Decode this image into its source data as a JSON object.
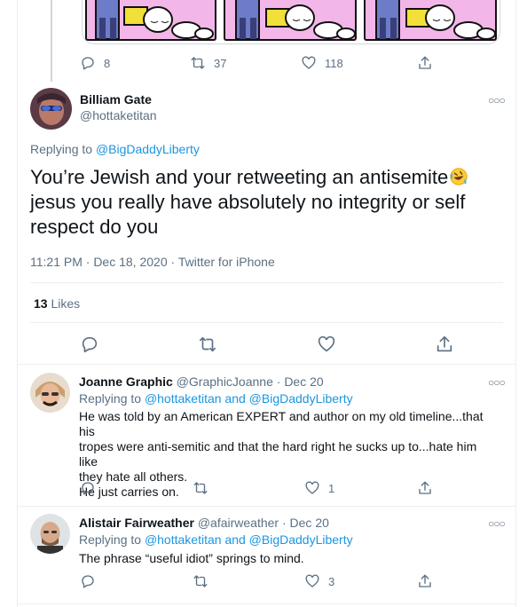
{
  "parent_tweet": {
    "counts": {
      "replies": "8",
      "retweets": "37",
      "likes": "118"
    }
  },
  "main_tweet": {
    "name": "Billiam Gate",
    "handle": "@hottaketitan",
    "replying_prefix": "Replying to",
    "replying_to": "@BigDaddyLiberty",
    "text": "You’re Jewish and your retweeting an antisemite",
    "text_cont": "jesus you really have absolutely no integrity or self respect do you",
    "timestamp": "11:21 PM · Dec 18, 2020",
    "source": "Twitter for iPhone",
    "likes_count": "13",
    "likes_label": "Likes"
  },
  "replies": [
    {
      "name": "Joanne Graphic",
      "handle": "@GraphicJoanne",
      "date": "· Dec 20",
      "replying_prefix": "Replying to",
      "replying_to": "@hottaketitan and @BigDaddyLiberty",
      "lines": [
        "He was told by an American EXPERT and author on my old timeline...that his",
        "tropes were anti-semitic and that the hard right he sucks up to...hate him like",
        "they hate all others.",
        "He just carries on."
      ],
      "counts": {
        "replies": "",
        "retweets": "",
        "likes": "1"
      }
    },
    {
      "name": "Alistair Fairweather",
      "handle": "@afairweather",
      "date": "· Dec 20",
      "replying_prefix": "Replying to",
      "replying_to": "@hottaketitan and @BigDaddyLiberty",
      "lines": [
        "The phrase “useful idiot” springs to mind."
      ],
      "counts": {
        "replies": "",
        "retweets": "",
        "likes": "3"
      }
    }
  ],
  "icons": {
    "reply": "speech-bubble",
    "retweet": "retweet-arrows",
    "like": "heart",
    "share": "share-upload",
    "more": "ellipsis"
  },
  "colors": {
    "link": "#1b95e0",
    "muted": "#5b7083",
    "text": "#0f1419",
    "border": "#ebeef0"
  }
}
